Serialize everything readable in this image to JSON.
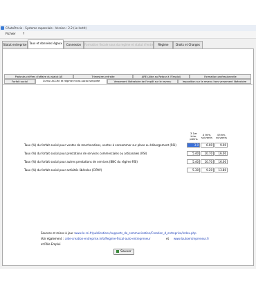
{
  "window": {
    "title": "CAutoPrecie - Systeme rapanciale  -  Version : 2.2 (Le Instit)"
  },
  "menu": {
    "file": "Fichier",
    "help": "?"
  },
  "tabs": [
    {
      "label": "Statut entreprise"
    },
    {
      "label": "Taux et données légaux"
    },
    {
      "label": "Connexion"
    },
    {
      "label": "Formation fiscale sous du regime et statut d'entreprise"
    },
    {
      "label": "Régime"
    },
    {
      "label": "Droits et Charges"
    }
  ],
  "subtabs_top": [
    {
      "label": "Plafonds chiffres d'affaire du statut AE"
    },
    {
      "label": "Trimestres retraite"
    },
    {
      "label": "ARE (Aide au Retour à l'Emploi)"
    },
    {
      "label": "Formation professionnelle"
    }
  ],
  "subtabs_bottom": [
    {
      "label": "Forfait social"
    },
    {
      "label": "Cumul ACCRE et régime micro-social simplifié"
    },
    {
      "label": "Versement libératoire de l'impôt sur le revenu"
    },
    {
      "label": "Imposition sur le revenu hors versement libératoire"
    }
  ],
  "table": {
    "headers": [
      "3 1er trim. pleins",
      "4 trim. suivants",
      "4 trim. suivants"
    ],
    "rows": [
      {
        "label": "Taux (%) du forfait social pour ventes de marchandises, ventes à consommer sur place ou hébergement  (RSI)",
        "values": [
          "3.0",
          "6.00",
          "9.00"
        ]
      },
      {
        "label": "Taux (%) du forfait social pour prestations de services commerciales ou artisanales (RSI)",
        "values": [
          "5.40",
          "10.70",
          "16.00"
        ]
      },
      {
        "label": "Taux (%) du forfait social pour autres prestations de services (BNC du régime RSI)",
        "values": [
          "5.40",
          "10.70",
          "16.00"
        ]
      },
      {
        "label": "Taux (%) du forfait social pour activités libérales (CIPAV)",
        "values": [
          "5.30",
          "9.20",
          "13.80"
        ]
      }
    ]
  },
  "sources": {
    "label": "Sources et mises à jour :",
    "url1": "www.le-rsi.fr/publications/supports_de_communication/Creation_d_entreprise/index.php",
    "see_also": "Voir également :",
    "url2": "aide-creation-entreprise.info/Regime-fiscal-auto-entrepreneur",
    "and": "et",
    "url3": "www.lautoentrepreneur.fr",
    "line3": "et Pôle Emploi"
  },
  "save_button": {
    "label": "Sauver"
  }
}
